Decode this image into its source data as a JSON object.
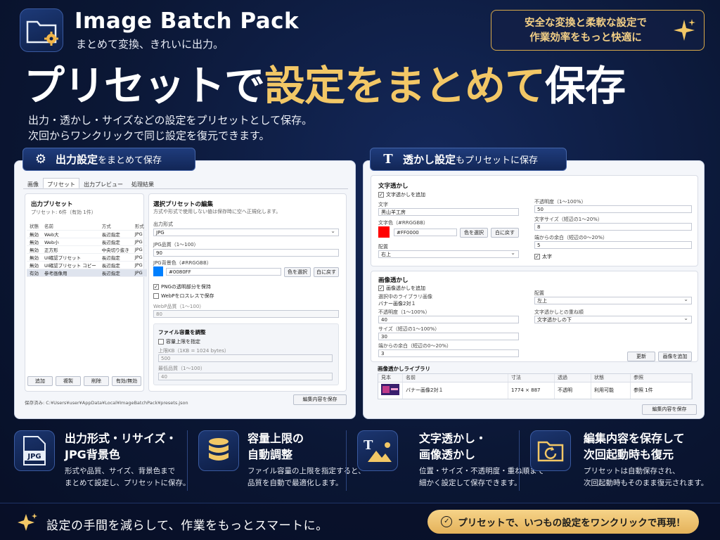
{
  "header": {
    "app_title": "Image Batch Pack",
    "app_subtitle": "まとめて変換、きれいに出力。",
    "badge_line1": "安全な変換と柔軟な設定で",
    "badge_line2": "作業効率をもっと快適に",
    "headline_white1": "プリセットで",
    "headline_gold": "設定をまとめて",
    "headline_white2": "保存",
    "desc_line1": "出力・透かし・サイズなどの設定をプリセットとして保存。",
    "desc_line2": "次回からワンクリックで同じ設定を復元できます。"
  },
  "left_panel": {
    "tag_bold": "出力設定",
    "tag_rest": "をまとめて保存",
    "tabs": [
      {
        "label": "画像",
        "active": false
      },
      {
        "label": "プリセット",
        "active": true
      },
      {
        "label": "出力プレビュー",
        "active": false
      },
      {
        "label": "処理結果",
        "active": false
      }
    ],
    "list_title": "出力プリセット",
    "list_count": "プリセット: 6件（有効 1件）",
    "columns": [
      "状態",
      "名前",
      "方式",
      "形式"
    ],
    "rows": [
      {
        "status": "無効",
        "name": "Web大",
        "method": "長辺指定",
        "format": "JPG"
      },
      {
        "status": "無効",
        "name": "Web小",
        "method": "長辺指定",
        "format": "JPG"
      },
      {
        "status": "無効",
        "name": "正方形",
        "method": "中央切り抜き",
        "format": "JPG"
      },
      {
        "status": "無効",
        "name": "UI確認プリセット",
        "method": "長辺指定",
        "format": "JPG"
      },
      {
        "status": "無効",
        "name": "UI確認プリセット コピー",
        "method": "長辺指定",
        "format": "JPG"
      },
      {
        "status": "有効",
        "name": "参考画像用",
        "method": "長辺指定",
        "format": "JPG"
      }
    ],
    "btn_add": "追加",
    "btn_copy": "複製",
    "btn_delete": "削除",
    "btn_toggle": "有効/無効",
    "edit_title": "選択プリセットの編集",
    "edit_note": "方式や形式で使用しない値は保存時に空へ正規化します。",
    "format_label": "出力形式",
    "format_value": "JPG",
    "jpg_quality_label": "JPG品質（1〜100）",
    "jpg_quality_value": "90",
    "jpg_bg_label": "JPG背景色（#RRGGBB）",
    "jpg_bg_value": "#0080FF",
    "jpg_bg_color": "#0080FF",
    "btn_pick_color": "色を選択",
    "btn_reset_white": "白に戻す",
    "png_keep_alpha": "PNGの透明部分を保持",
    "webp_lossless": "WebPをロスレスで保存",
    "webp_quality_label": "WebP品質（1〜100）",
    "webp_quality_value": "80",
    "size_group_title": "ファイル容量を調整",
    "size_limit_check": "容量上限を指定",
    "size_limit_label": "上限KB（1KB = 1024 bytes）",
    "size_limit_value": "500",
    "min_quality_label": "最低品質（1〜100）",
    "min_quality_value": "40",
    "save_path": "保存済み: C:¥Users¥user¥AppData¥Local¥ImageBatchPack¥presets.json",
    "btn_save": "編集内容を保存"
  },
  "right_panel": {
    "tag_bold": "透かし設定",
    "tag_rest": "もプリセットに保存",
    "text_section_title": "文字透かし",
    "text_enable": "文字透かしを追加",
    "text_label": "文字",
    "text_value": "黒山羊工房",
    "text_color_label": "文字色（#RRGGBB）",
    "text_color_value": "#FF0000",
    "text_color": "#FF0000",
    "btn_pick_color": "色を選択",
    "btn_reset_white": "白に戻す",
    "position_label": "配置",
    "position_value": "右上",
    "opacity_label": "不透明度（1〜100%）",
    "opacity_value": "50",
    "font_size_label": "文字サイズ（短辺の1〜20%）",
    "font_size_value": "8",
    "margin_label": "端からの余白（短辺の0〜20%）",
    "margin_value": "5",
    "bold_label": "太字",
    "image_section_title": "画像透かし",
    "image_enable": "画像透かしを追加",
    "library_selected_label": "選択中のライブラリ画像",
    "library_selected_value": "バナー画像2対１",
    "img_opacity_label": "不透明度（1〜100%）",
    "img_opacity_value": "40",
    "img_size_label": "サイズ（短辺の1〜100%）",
    "img_size_value": "30",
    "img_margin_label": "端からの余白（短辺の0〜20%）",
    "img_margin_value": "3",
    "img_position_label": "配置",
    "img_position_value": "左上",
    "overlap_label": "文字透かしとの重ね順",
    "overlap_value": "文字透かしの下",
    "btn_update": "更新",
    "btn_add_image": "画像を追加",
    "library_title": "画像透かしライブラリ",
    "library_columns": [
      "見本",
      "名前",
      "寸法",
      "透過",
      "状態",
      "参照"
    ],
    "library_row": {
      "name": "バナー画像2対１",
      "size": "1774 × 887",
      "alpha": "不透明",
      "status": "利用可能",
      "ref": "参照 1件"
    },
    "btn_save": "編集内容を保存"
  },
  "features": [
    {
      "icon": "jpg-file-icon",
      "title1": "出力形式・リサイズ・",
      "title2": "JPG背景色",
      "text1": "形式や品質、サイズ、背景色まで",
      "text2": "まとめて設定し、プリセットに保存。",
      "icon_text": "JPG"
    },
    {
      "icon": "database-icon",
      "title1": "容量上限の",
      "title2": "自動調整",
      "text1": "ファイル容量の上限を指定すると、",
      "text2": "品質を自動で最適化します。"
    },
    {
      "icon": "watermark-icon",
      "title1": "文字透かし・",
      "title2": "画像透かし",
      "text1": "位置・サイズ・不透明度・重ね順まで",
      "text2": "細かく設定して保存できます。",
      "icon_text": "T"
    },
    {
      "icon": "folder-restore-icon",
      "title1": "編集内容を保存して",
      "title2": "次回起動時も復元",
      "text1": "プリセットは自動保存され、",
      "text2": "次回起動時もそのまま復元されます。"
    }
  ],
  "footer": {
    "text": "設定の手間を減らして、作業をもっとスマートに。",
    "pill": "プリセットで、いつもの設定をワンクリックで再現！"
  },
  "colors": {
    "gold": "#F2C766",
    "navy": "#0B1735"
  }
}
